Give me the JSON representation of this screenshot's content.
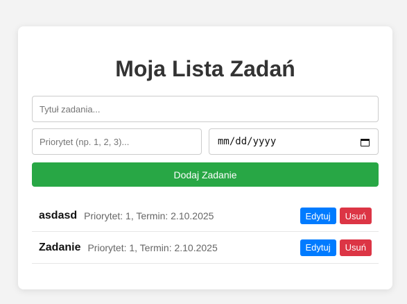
{
  "header": {
    "title": "Moja Lista Zadań"
  },
  "form": {
    "title_placeholder": "Tytuł zadania...",
    "title_value": "",
    "priority_placeholder": "Priorytet (np. 1, 2, 3)...",
    "priority_value": "",
    "date_placeholder": "mm/dd/yyyy",
    "date_icon": "calendar-icon",
    "add_label": "Dodaj Zadanie"
  },
  "tasks": [
    {
      "name": "asdasd",
      "meta": "Priorytet: 1, Termin: 2.10.2025",
      "edit_label": "Edytuj",
      "delete_label": "Usuń"
    },
    {
      "name": "Zadanie",
      "meta": "Priorytet: 1, Termin: 2.10.2025",
      "edit_label": "Edytuj",
      "delete_label": "Usuń"
    }
  ],
  "colors": {
    "add_button": "#28a745",
    "edit_button": "#007bff",
    "delete_button": "#dc3545"
  }
}
